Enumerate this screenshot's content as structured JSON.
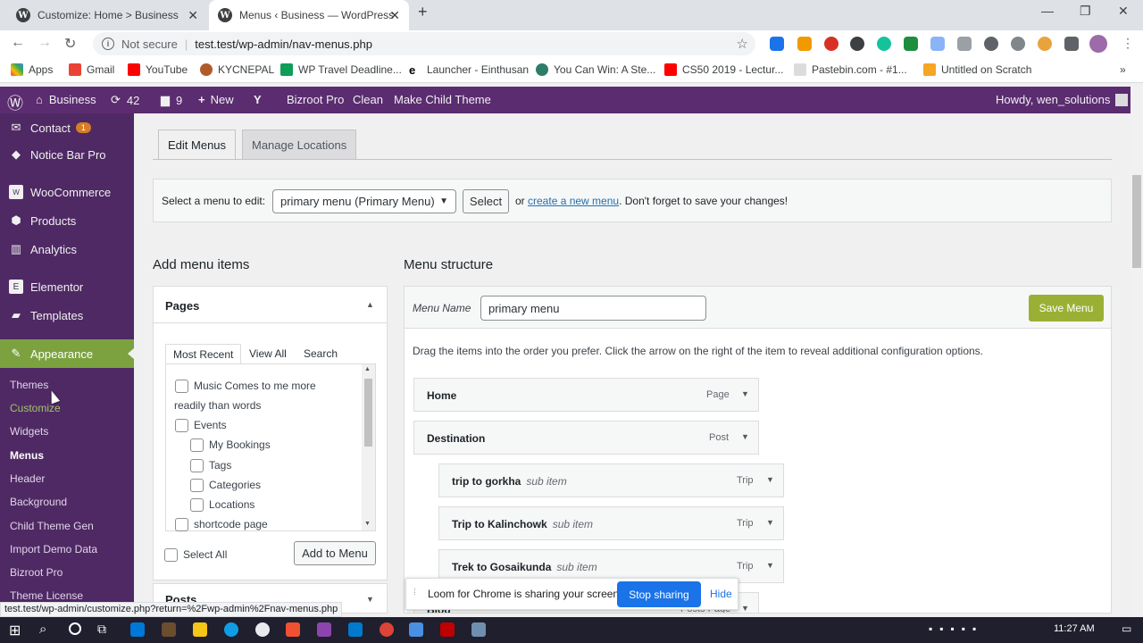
{
  "browser": {
    "tabs": [
      {
        "title": "Customize: Home > Business",
        "close": "✕"
      },
      {
        "title": "Menus ‹ Business — WordPress",
        "close": "✕"
      }
    ],
    "new_tab": "+",
    "window_controls": [
      "—",
      "❐",
      "✕"
    ],
    "address": {
      "not_secure": "Not secure",
      "url": "test.test/wp-admin/nav-menus.php"
    },
    "bookmarks": [
      "Apps",
      "Gmail",
      "YouTube",
      "KYCNEPAL",
      "WP Travel Deadline...",
      "Launcher - Einthusan",
      "You Can Win: A Ste...",
      "CS50 2019 - Lectur...",
      "Pastebin.com - #1...",
      "Untitled on Scratch"
    ],
    "bookmarks_more": "»"
  },
  "adminbar": {
    "site": "Business",
    "updates": "42",
    "comments": "9",
    "new": "New",
    "items": [
      "Bizroot Pro",
      "Clean",
      "Make Child Theme"
    ],
    "howdy": "Howdy, wen_solutions"
  },
  "sidebar": {
    "contact": "Contact",
    "contact_badge": "1",
    "notice_bar": "Notice Bar Pro",
    "woocommerce": "WooCommerce",
    "products": "Products",
    "analytics": "Analytics",
    "elementor": "Elementor",
    "templates": "Templates",
    "appearance": "Appearance",
    "sub": [
      "Themes",
      "Customize",
      "Widgets",
      "Menus",
      "Header",
      "Background",
      "Child Theme Gen",
      "Import Demo Data",
      "Bizroot Pro",
      "Theme License"
    ]
  },
  "tabs": {
    "edit": "Edit Menus",
    "manage": "Manage Locations"
  },
  "select_row": {
    "label": "Select a menu to edit:",
    "selected": "primary menu (Primary Menu)",
    "select_btn": "Select",
    "or": "or",
    "create_link": "create a new menu",
    "tail": ". Don't forget to save your changes!"
  },
  "add_items": {
    "heading": "Add menu items",
    "pages_title": "Pages",
    "inner_tabs": [
      "Most Recent",
      "View All",
      "Search"
    ],
    "pages": [
      "Music Comes to me more",
      "readily than words",
      "Events",
      "My Bookings",
      "Tags",
      "Categories",
      "Locations",
      "shortcode page"
    ],
    "select_all": "Select All",
    "add_btn": "Add to Menu",
    "posts_title": "Posts"
  },
  "structure": {
    "heading": "Menu structure",
    "name_label": "Menu Name",
    "name_value": "primary menu",
    "save": "Save Menu",
    "instructions": "Drag the items into the order you prefer. Click the arrow on the right of the item to reveal additional configuration options.",
    "items": [
      {
        "title": "Home",
        "sub": "",
        "type": "Page"
      },
      {
        "title": "Destination",
        "sub": "",
        "type": "Post"
      },
      {
        "title": "trip to gorkha",
        "sub": "sub item",
        "type": "Trip"
      },
      {
        "title": "Trip to Kalinchowk",
        "sub": "sub item",
        "type": "Trip"
      },
      {
        "title": "Trek to Gosaikunda",
        "sub": "sub item",
        "type": "Trip"
      },
      {
        "title": "Blog",
        "sub": "",
        "type": "Posts Page"
      }
    ]
  },
  "loom": {
    "message": "Loom for Chrome is sharing your screen.",
    "stop": "Stop sharing",
    "hide": "Hide"
  },
  "status_url": "test.test/wp-admin/customize.php?return=%2Fwp-admin%2Fnav-menus.php",
  "taskbar": {
    "time": "11:27 AM"
  }
}
